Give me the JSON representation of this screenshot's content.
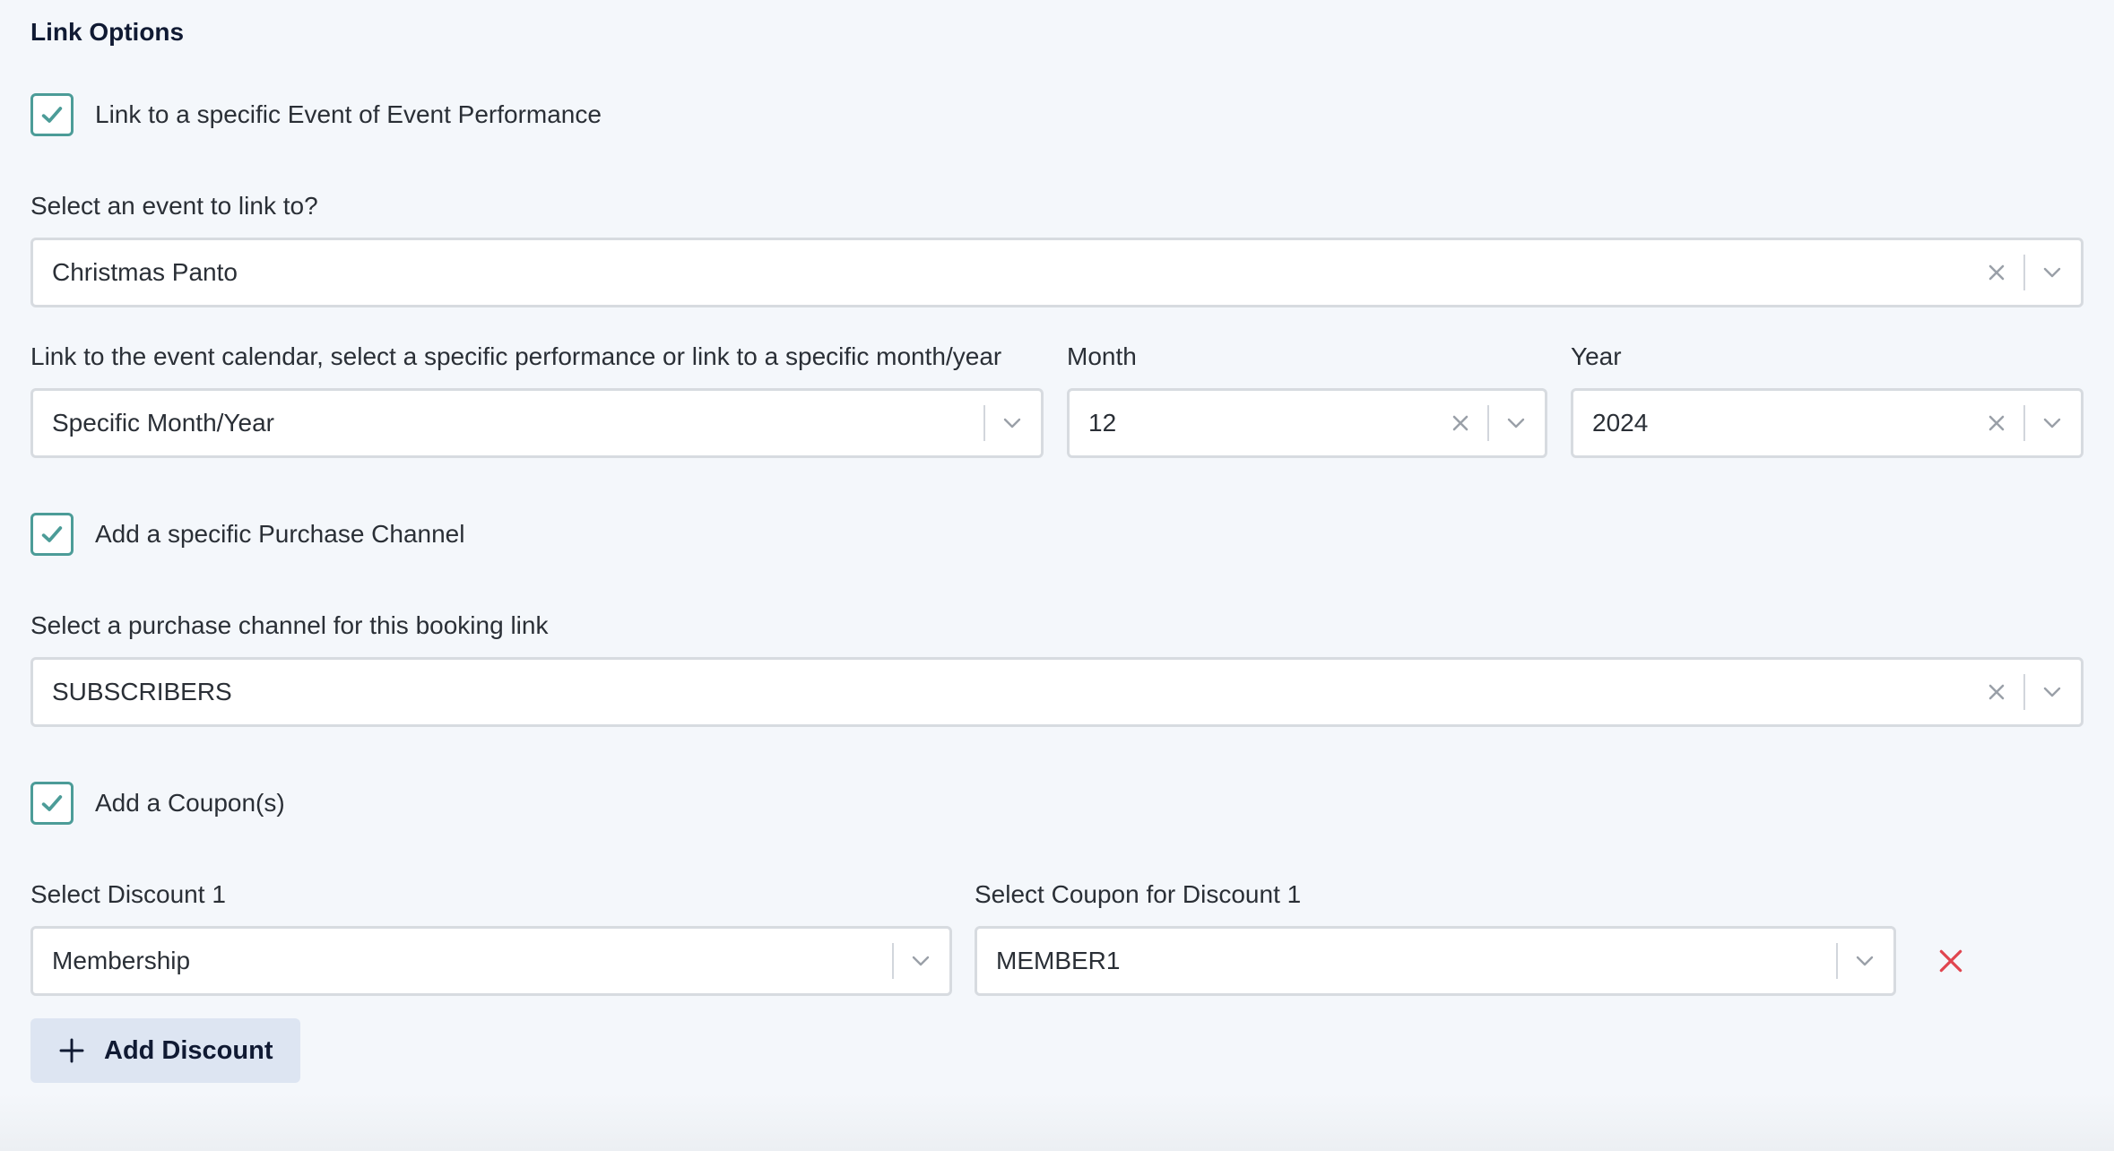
{
  "section_title": "Link Options",
  "link_event_checkbox": {
    "label": "Link to a specific Event of Event Performance",
    "checked": true
  },
  "event_select": {
    "label": "Select an event to link to?",
    "value": "Christmas Panto"
  },
  "calendar_select": {
    "label": "Link to the event calendar, select a specific performance or link to a specific month/year",
    "value": "Specific Month/Year"
  },
  "month_select": {
    "label": "Month",
    "value": "12"
  },
  "year_select": {
    "label": "Year",
    "value": "2024"
  },
  "purchase_channel_checkbox": {
    "label": "Add a specific Purchase Channel",
    "checked": true
  },
  "purchase_channel_select": {
    "label": "Select a purchase channel for this booking link",
    "value": "SUBSCRIBERS"
  },
  "coupon_checkbox": {
    "label": "Add a Coupon(s)",
    "checked": true
  },
  "discount_select": {
    "label": "Select Discount 1",
    "value": "Membership"
  },
  "coupon_select": {
    "label": "Select Coupon for Discount 1",
    "value": "MEMBER1"
  },
  "add_discount_label": "Add Discount",
  "colors": {
    "accent": "#4c9c98",
    "remove": "#e0454f",
    "button_bg": "#dde5f2"
  },
  "icons": {
    "check": "check-icon",
    "clear": "close-icon",
    "chevron": "chevron-down-icon",
    "plus": "plus-icon",
    "remove": "remove-icon"
  }
}
